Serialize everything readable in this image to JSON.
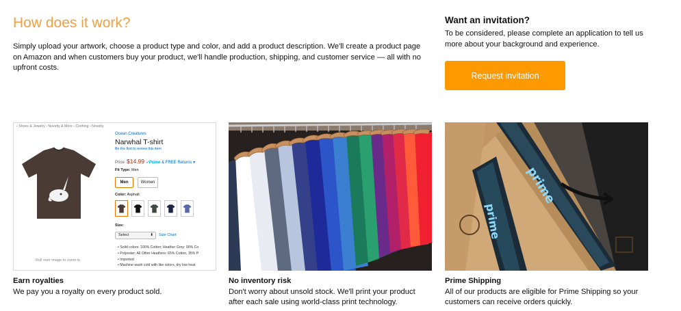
{
  "how": {
    "title": "How does it work?",
    "text": "Simply upload your artwork, choose a product type and color, and add a product description. We'll create a product page on Amazon and when customers buy your product, we'll handle production, shipping, and customer service — all with no upfront costs."
  },
  "invitation": {
    "title": "Want an invitation?",
    "text": "To be considered, please complete an application to tell us more about your background and experience.",
    "button": "Request invitation"
  },
  "product_page": {
    "breadcrumb": "‹ Shoes & Jewelry › Novelty & More › Clothing › Novelty",
    "brand": "Ocean Creatures",
    "name": "Narwhal T-shirt",
    "review_link": "Be the first to review this item",
    "price_label": "Price:",
    "price": "$14.99",
    "prime": "✓Prime",
    "shipping": "& FREE Returns",
    "fit_label": "Fit Type:",
    "fit_value": "Men",
    "fit_options": [
      "Men",
      "Women"
    ],
    "color_label": "Color:",
    "color_value": "Asphalt",
    "size_label": "Size:",
    "size_select": "Select",
    "size_chart": "Size Chart",
    "bullets": [
      "Solid colors: 100% Cotton; Heather Grey: 90% Co",
      "Polyester; All Other Heathers: 65% Cotton, 35% P",
      "Imported",
      "Machine wash cold with like colors, dry low heat"
    ],
    "zoom_hint": "Roll over image to zoom in"
  },
  "cards": [
    {
      "title": "Earn royalties",
      "text": "We pay you a royalty on every product sold."
    },
    {
      "title": "No inventory risk",
      "text": "Don't worry about unsold stock. We'll print your product after each sale using world-class print technology."
    },
    {
      "title": "Prime Shipping",
      "text": "All of our products are eligible for Prime Shipping so your customers can receive orders quickly."
    }
  ],
  "colors": {
    "accent": "#f0a040",
    "button": "#ff9900",
    "link": "#0066c0",
    "price": "#b12704",
    "prime_tape": "#00a8e1"
  },
  "box_tape_text": "prime"
}
